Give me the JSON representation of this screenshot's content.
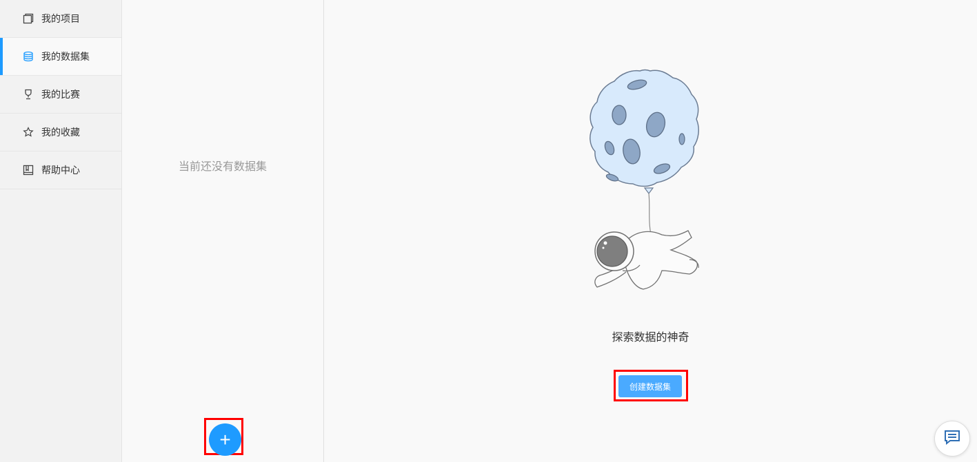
{
  "sidebar": {
    "items": [
      {
        "label": "我的项目",
        "icon": "project-icon"
      },
      {
        "label": "我的数据集",
        "icon": "database-icon",
        "active": true
      },
      {
        "label": "我的比赛",
        "icon": "trophy-icon"
      },
      {
        "label": "我的收藏",
        "icon": "star-icon"
      },
      {
        "label": "帮助中心",
        "icon": "book-icon"
      }
    ]
  },
  "list_panel": {
    "empty_text": "当前还没有数据集",
    "add_button_label": "+"
  },
  "main": {
    "tagline": "探索数据的神奇",
    "create_button_label": "创建数据集"
  },
  "colors": {
    "accent": "#1e9bff",
    "highlight": "#ff0000",
    "create_button": "#4aaaff"
  }
}
